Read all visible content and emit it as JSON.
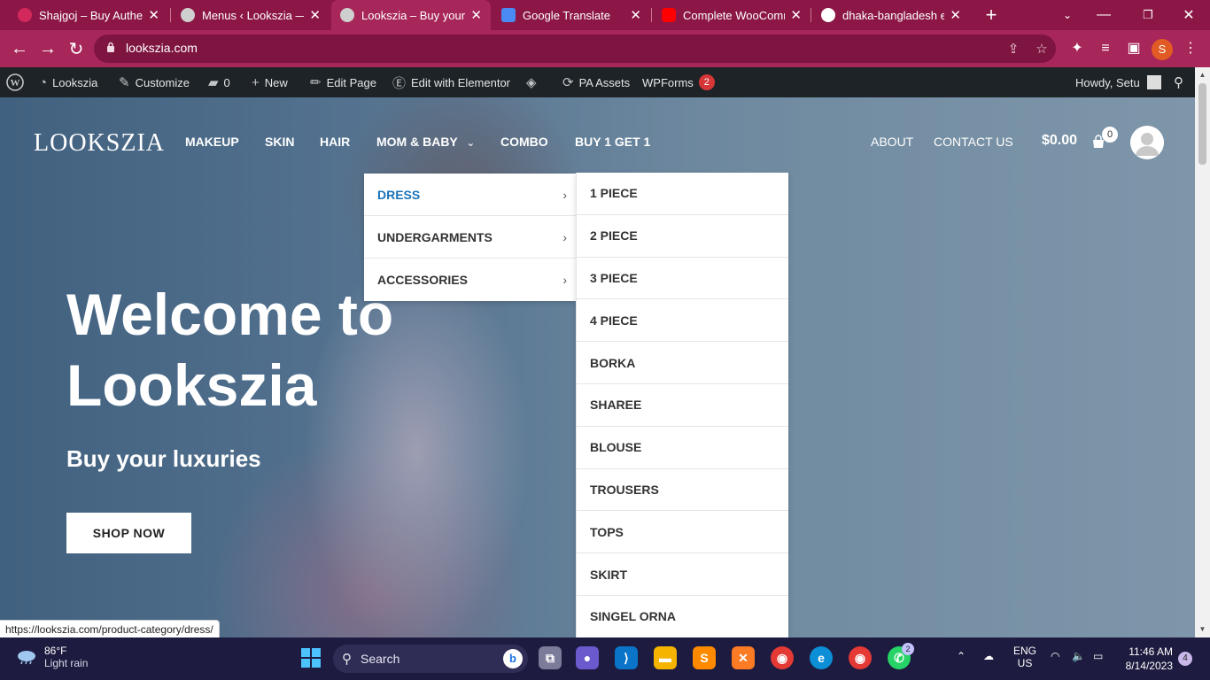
{
  "browser": {
    "tabs": [
      {
        "title": "Shajgoj – Buy Authent",
        "favicon_color": "#d3285b",
        "active": false
      },
      {
        "title": "Menus ‹ Lookszia — W",
        "favicon_color": "#cfcfcf",
        "active": false
      },
      {
        "title": "Lookszia – Buy your lu",
        "favicon_color": "#cfcfcf",
        "active": true
      },
      {
        "title": "Google Translate",
        "favicon_color": "#4a8af4",
        "active": false
      },
      {
        "title": "Complete WooComme",
        "favicon_color": "#ff0000",
        "active": false
      },
      {
        "title": "dhaka-bangladesh er",
        "favicon_color": "#ffffff",
        "active": false
      }
    ],
    "new_tab_label": "+",
    "url": "lookszia.com",
    "profile_initial": "S",
    "status_url": "https://lookszia.com/product-category/dress/"
  },
  "adminbar": {
    "items": [
      {
        "id": "site",
        "label": "Lookszia",
        "icon": "dashboard-icon"
      },
      {
        "id": "customize",
        "label": "Customize",
        "icon": "brush-icon"
      },
      {
        "id": "comments",
        "label": "0",
        "icon": "comment-icon"
      },
      {
        "id": "new",
        "label": "New",
        "icon": "plus-icon"
      },
      {
        "id": "edit",
        "label": "Edit Page",
        "icon": "pencil-icon"
      },
      {
        "id": "elementor",
        "label": "Edit with Elementor",
        "icon": "elementor-icon"
      },
      {
        "id": "pa",
        "label": "PA Assets",
        "icon": "sync-icon"
      },
      {
        "id": "wpforms",
        "label": "WPForms",
        "badge": "2"
      }
    ],
    "howdy": "Howdy, Setu"
  },
  "site": {
    "logo": "LOOKSZIA",
    "nav": [
      "MAKEUP",
      "SKIN",
      "HAIR",
      "MOM & BABY",
      "COMBO",
      "BUY 1 GET 1"
    ],
    "right_nav": [
      "ABOUT",
      "CONTACT US"
    ],
    "cart_total": "$0.00",
    "cart_count": "0"
  },
  "hero": {
    "title": "Welcome to Lookszia",
    "subtitle": "Buy your luxuries",
    "cta": "SHOP NOW"
  },
  "dropdown": {
    "level1": [
      "DRESS",
      "UNDERGARMENTS",
      "ACCESSORIES"
    ],
    "level2": [
      "1 PIECE",
      "2 PIECE",
      "3 PIECE",
      "4 PIECE",
      "BORKA",
      "SHAREE",
      "BLOUSE",
      "TROUSERS",
      "TOPS",
      "SKIRT",
      "SINGEL ORNA"
    ]
  },
  "taskbar": {
    "weather_temp": "86°F",
    "weather_cond": "Light rain",
    "search_placeholder": "Search",
    "lang_1": "ENG",
    "lang_2": "US",
    "time": "11:46 AM",
    "date": "8/14/2023",
    "notifications": "4",
    "whatsapp_badge": "2"
  }
}
